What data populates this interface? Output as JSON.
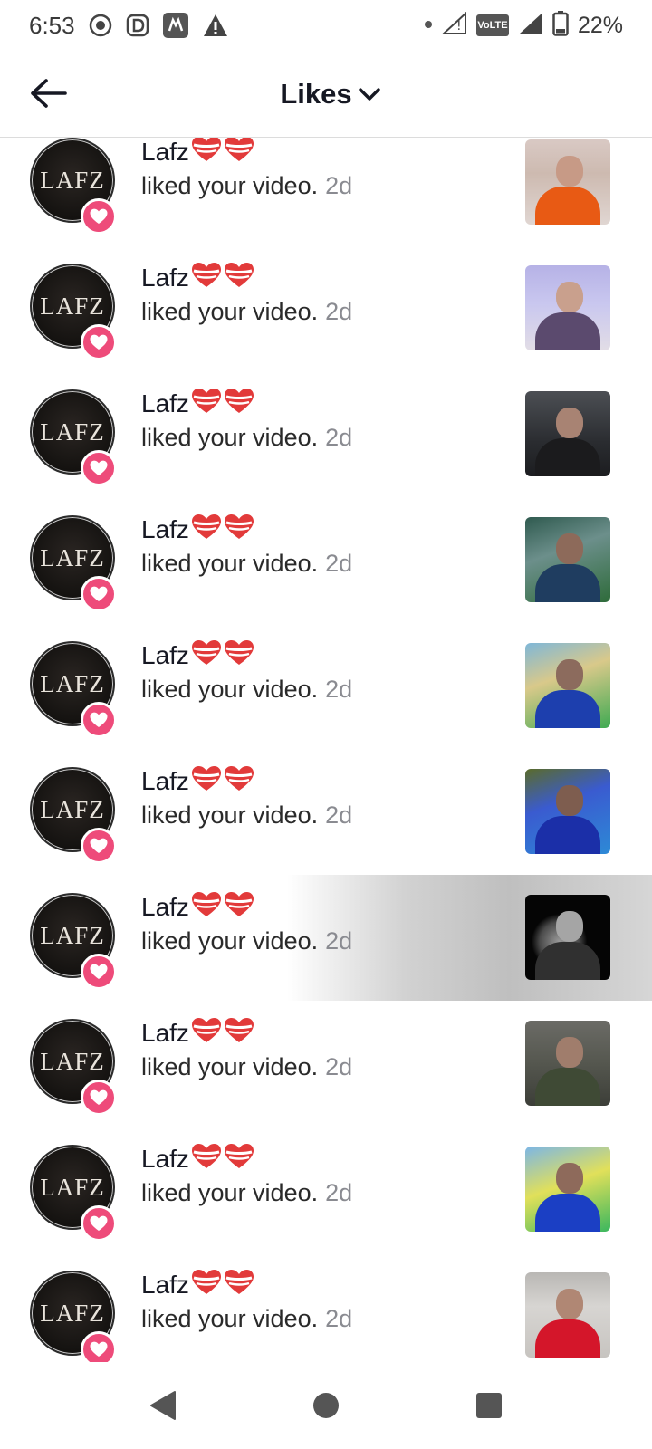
{
  "status_bar": {
    "time": "6:53",
    "battery_percent": "22%",
    "network_label": "VoLTE"
  },
  "header": {
    "title": "Likes"
  },
  "notifications": [
    {
      "username": "Lafz",
      "message": "liked your video.",
      "time": "2d",
      "avatar_text": "LAFZ"
    },
    {
      "username": "Lafz",
      "message": "liked your video.",
      "time": "2d",
      "avatar_text": "LAFZ"
    },
    {
      "username": "Lafz",
      "message": "liked your video.",
      "time": "2d",
      "avatar_text": "LAFZ"
    },
    {
      "username": "Lafz",
      "message": "liked your video.",
      "time": "2d",
      "avatar_text": "LAFZ"
    },
    {
      "username": "Lafz",
      "message": "liked your video.",
      "time": "2d",
      "avatar_text": "LAFZ"
    },
    {
      "username": "Lafz",
      "message": "liked your video.",
      "time": "2d",
      "avatar_text": "LAFZ"
    },
    {
      "username": "Lafz",
      "message": "liked your video.",
      "time": "2d",
      "avatar_text": "LAFZ"
    },
    {
      "username": "Lafz",
      "message": "liked your video.",
      "time": "2d",
      "avatar_text": "LAFZ"
    },
    {
      "username": "Lafz",
      "message": "liked your video.",
      "time": "2d",
      "avatar_text": "LAFZ"
    },
    {
      "username": "Lafz",
      "message": "liked your video.",
      "time": "2d",
      "avatar_text": "LAFZ"
    }
  ],
  "colors": {
    "like_badge": "#ee4b7a",
    "text_primary": "#161823",
    "text_secondary": "#8a8b91"
  }
}
